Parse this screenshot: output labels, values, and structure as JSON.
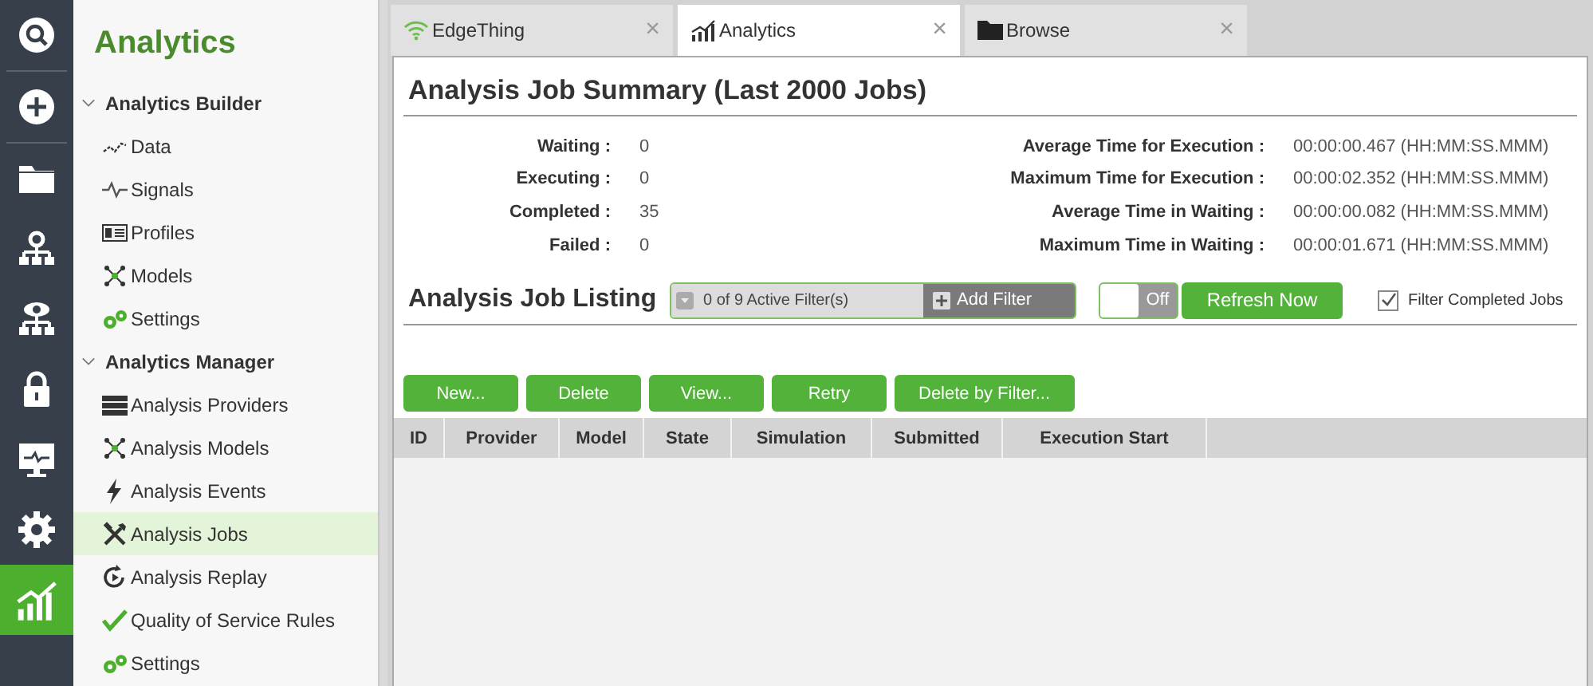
{
  "rail": [
    {
      "kind": "search",
      "selected": false
    },
    {
      "kind": "plus",
      "selected": false
    },
    {
      "kind": "folder",
      "selected": false
    },
    {
      "kind": "network",
      "selected": false
    },
    {
      "kind": "eye-network",
      "selected": false
    },
    {
      "kind": "lock",
      "selected": false
    },
    {
      "kind": "monitor",
      "selected": false
    },
    {
      "kind": "gear",
      "selected": false
    },
    {
      "kind": "chart",
      "selected": true
    }
  ],
  "sidebar": {
    "title": "Analytics",
    "groups": [
      {
        "label": "Analytics Builder",
        "expanded": true,
        "items": [
          {
            "label": "Data",
            "kind": "data",
            "selected": false
          },
          {
            "label": "Signals",
            "kind": "signal",
            "selected": false
          },
          {
            "label": "Profiles",
            "kind": "profile",
            "selected": false
          },
          {
            "label": "Models",
            "kind": "model",
            "selected": false
          },
          {
            "label": "Settings",
            "kind": "gears",
            "selected": false
          }
        ]
      },
      {
        "label": "Analytics Manager",
        "expanded": true,
        "items": [
          {
            "label": "Analysis Providers",
            "kind": "server",
            "selected": false
          },
          {
            "label": "Analysis Models",
            "kind": "model",
            "selected": false
          },
          {
            "label": "Analysis Events",
            "kind": "bolt",
            "selected": false
          },
          {
            "label": "Analysis Jobs",
            "kind": "tools",
            "selected": true
          },
          {
            "label": "Analysis Replay",
            "kind": "replay",
            "selected": false
          },
          {
            "label": "Quality of Service Rules",
            "kind": "check",
            "selected": false
          },
          {
            "label": "Settings",
            "kind": "gears",
            "selected": false
          }
        ]
      }
    ]
  },
  "tabs": [
    {
      "label": "EdgeThing",
      "kind": "wifi",
      "selected": false,
      "close": "×"
    },
    {
      "label": "Analytics",
      "kind": "chart",
      "selected": true,
      "close": "×"
    },
    {
      "label": "Browse",
      "kind": "folder",
      "selected": false,
      "close": "×"
    }
  ],
  "summary": {
    "title": "Analysis Job Summary (Last 2000 Jobs)",
    "counts": [
      {
        "label": "Waiting :",
        "value": "0"
      },
      {
        "label": "Executing :",
        "value": "0"
      },
      {
        "label": "Completed :",
        "value": "35"
      },
      {
        "label": "Failed :",
        "value": "0"
      }
    ],
    "times": [
      {
        "label": "Average Time for Execution :",
        "value": "00:00:00.467 (HH:MM:SS.MMM)"
      },
      {
        "label": "Maximum Time for Execution :",
        "value": "00:00:02.352 (HH:MM:SS.MMM)"
      },
      {
        "label": "Average Time in Waiting :",
        "value": "00:00:00.082 (HH:MM:SS.MMM)"
      },
      {
        "label": "Maximum Time in Waiting :",
        "value": "00:00:01.671 (HH:MM:SS.MMM)"
      }
    ]
  },
  "listing": {
    "title": "Analysis Job Listing",
    "filter": "0 of 9 Active Filter(s)",
    "add_filter": "Add Filter",
    "toggle": {
      "label": "Off",
      "on": false
    },
    "refresh": "Refresh Now",
    "filter_completed": {
      "label": "Filter Completed Jobs",
      "checked": true
    },
    "actions": [
      "New...",
      "Delete",
      "View...",
      "Retry",
      "Delete by Filter..."
    ],
    "columns": [
      "ID",
      "Provider",
      "Model",
      "State",
      "Simulation",
      "Submitted",
      "Execution Start"
    ]
  }
}
